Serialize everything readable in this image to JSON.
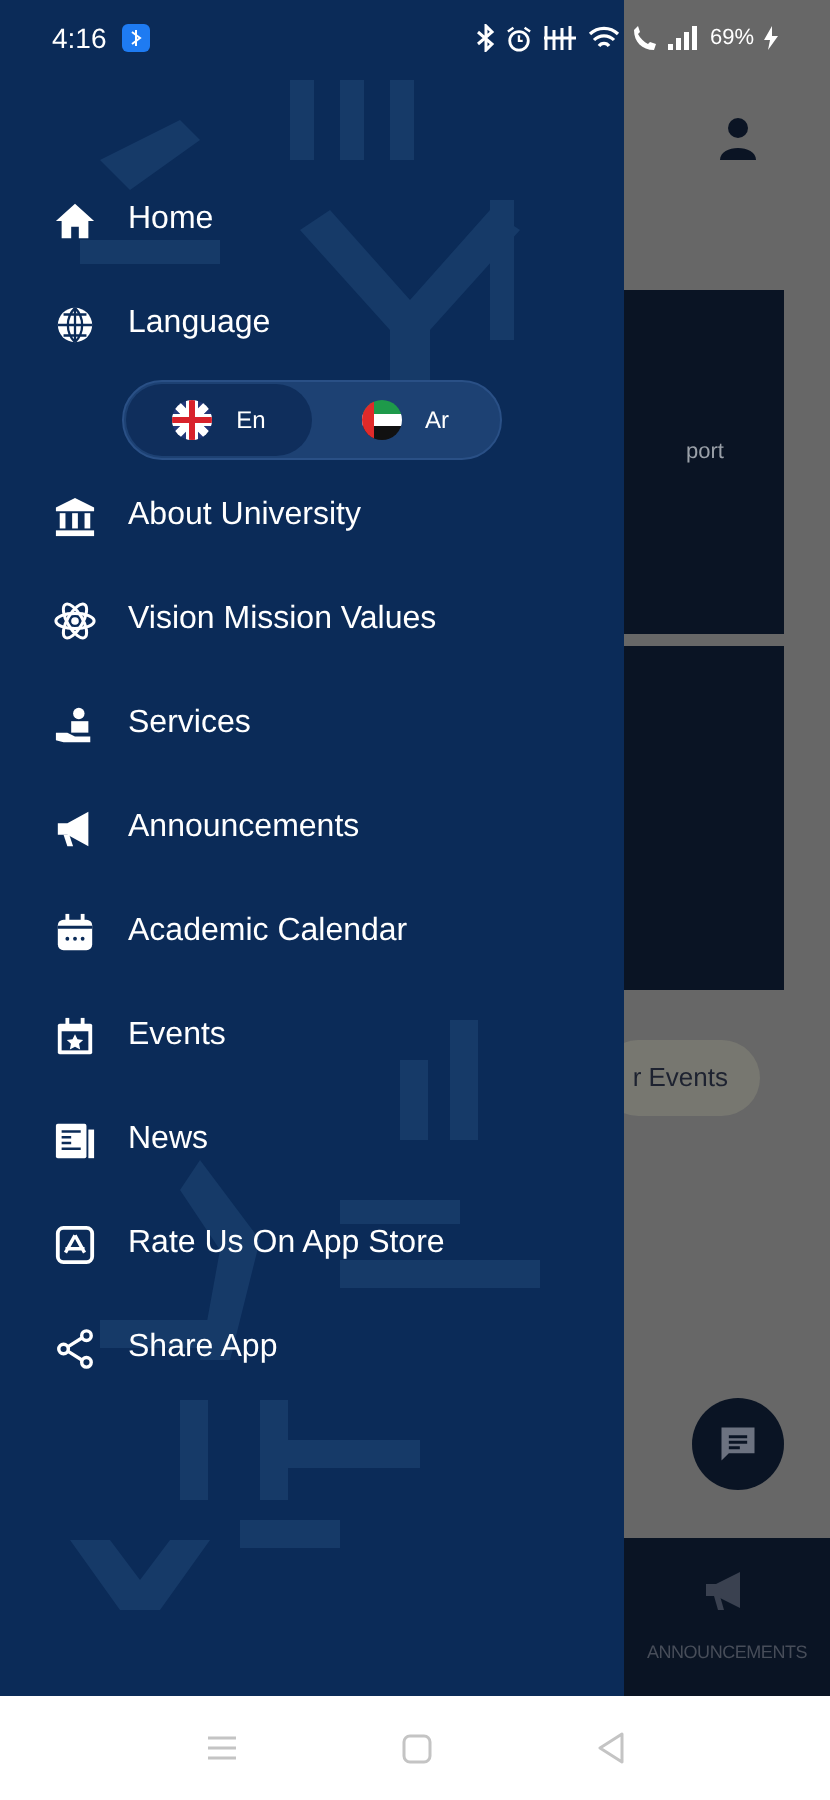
{
  "status_bar": {
    "time": "4:16",
    "battery": "69%"
  },
  "drawer": {
    "items": [
      {
        "kind": "link",
        "label": "Home"
      },
      {
        "kind": "link",
        "label": "Language"
      },
      {
        "kind": "language",
        "options": [
          {
            "label": "En",
            "selected": true
          },
          {
            "label": "Ar",
            "selected": false
          }
        ]
      },
      {
        "kind": "link",
        "label": "About University"
      },
      {
        "kind": "link",
        "label": "Vision Mission Values"
      },
      {
        "kind": "link",
        "label": "Services"
      },
      {
        "kind": "link",
        "label": "Announcements"
      },
      {
        "kind": "link",
        "label": "Academic Calendar"
      },
      {
        "kind": "link",
        "label": "Events"
      },
      {
        "kind": "link",
        "label": "News"
      },
      {
        "kind": "link",
        "label": "Rate Us On App Store"
      },
      {
        "kind": "link",
        "label": "Share App"
      }
    ]
  },
  "background_screen": {
    "card_label": "port",
    "chip": "r Events",
    "tab": "ANNOUNCEMENTS"
  }
}
